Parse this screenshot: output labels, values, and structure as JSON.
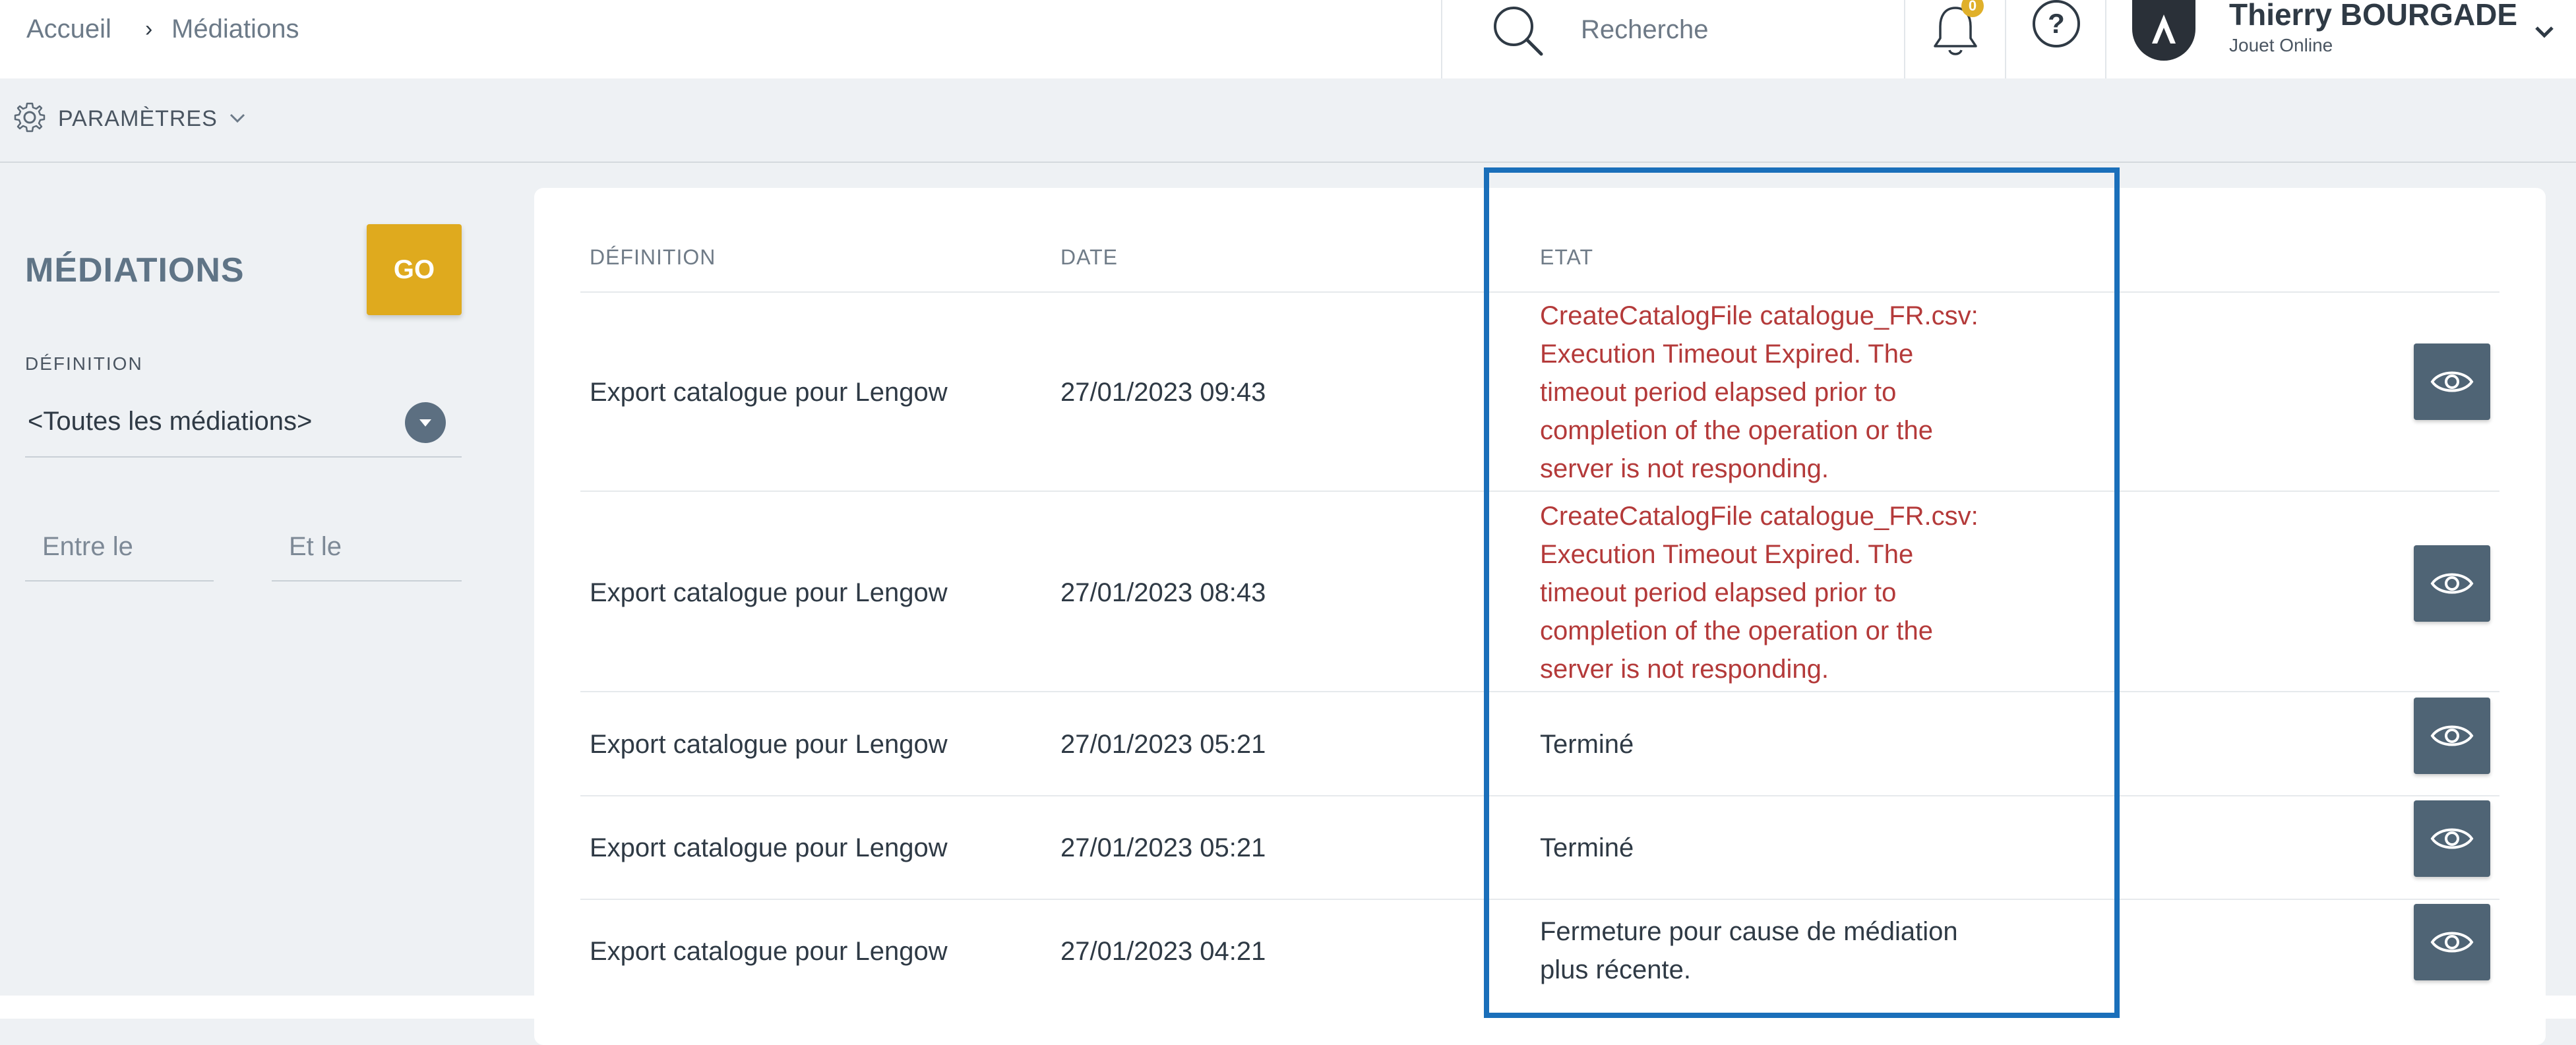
{
  "breadcrumb": {
    "home": "Accueil",
    "separator": "›",
    "current": "Médiations"
  },
  "search": {
    "placeholder": "Recherche"
  },
  "notifications": {
    "count": "0",
    "icon": "bell-icon"
  },
  "help": {
    "label": "?"
  },
  "user": {
    "name": "Thierry BOURGADE",
    "organization": "Jouet Online"
  },
  "settings": {
    "label": "PARAMÈTRES"
  },
  "filters": {
    "title": "MÉDIATIONS",
    "go_label": "GO",
    "definition_label": "DÉFINITION",
    "definition_value": "<Toutes les médiations>",
    "date_from_placeholder": "Entre le",
    "date_to_placeholder": "Et le"
  },
  "table": {
    "columns": {
      "definition": "DÉFINITION",
      "date": "DATE",
      "state": "ETAT"
    },
    "rows": [
      {
        "definition": "Export catalogue pour Lengow",
        "date": "27/01/2023 09:43",
        "state": [
          "CreateCatalogFile catalogue_FR.csv:",
          "Execution Timeout Expired. The",
          "timeout period elapsed prior to",
          "completion of the operation or the",
          "server is not responding."
        ],
        "error": true
      },
      {
        "definition": "Export catalogue pour Lengow",
        "date": "27/01/2023 08:43",
        "state": [
          "CreateCatalogFile catalogue_FR.csv:",
          "Execution Timeout Expired. The",
          "timeout period elapsed prior to",
          "completion of the operation or the",
          "server is not responding."
        ],
        "error": true
      },
      {
        "definition": "Export catalogue pour Lengow",
        "date": "27/01/2023 05:21",
        "state": [
          "Terminé"
        ],
        "error": false
      },
      {
        "definition": "Export catalogue pour Lengow",
        "date": "27/01/2023 05:21",
        "state": [
          "Terminé"
        ],
        "error": false
      },
      {
        "definition": "Export catalogue pour Lengow",
        "date": "27/01/2023 04:21",
        "state": [
          "Fermeture pour cause de médiation",
          "plus récente."
        ],
        "error": false
      }
    ]
  },
  "colors": {
    "accent": "#dfaa1e",
    "error": "#b43a3a",
    "highlight": "#1a6fba",
    "button": "#4f6475"
  }
}
